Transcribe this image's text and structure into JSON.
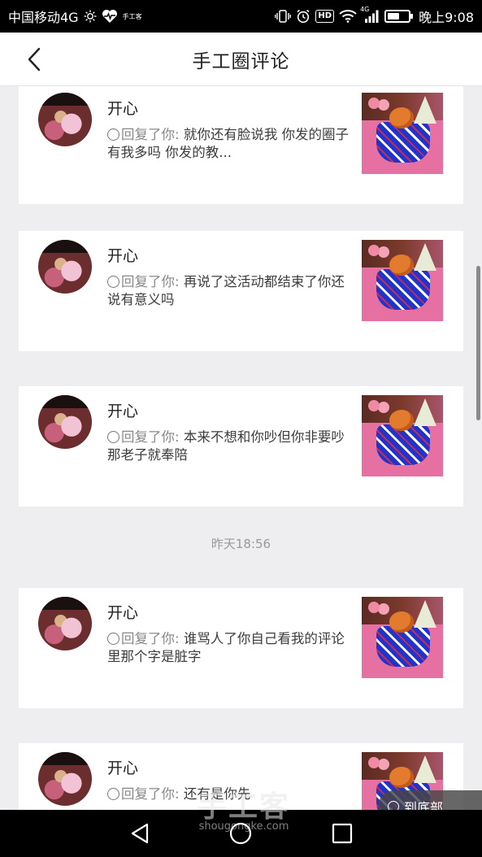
{
  "status_bar": {
    "carrier": "中国移动4G",
    "small_label": "手工客",
    "network_label": "4G",
    "hd_label": "HD",
    "time": "晚上9:08",
    "battery_level": 0.6
  },
  "header": {
    "title": "手工圈评论"
  },
  "comments": [
    {
      "username": "开心",
      "prefix": "回复了你:",
      "text": "就你还有脸说我 你发的圈子有我多吗 你发的教..."
    },
    {
      "username": "开心",
      "prefix": "回复了你:",
      "text": "再说了这活动都结束了你还说有意义吗"
    },
    {
      "username": "开心",
      "prefix": "回复了你:",
      "text": "本来不想和你吵但你非要吵那老子就奉陪"
    },
    {
      "username": "开心",
      "prefix": "回复了你:",
      "text": "谁骂人了你自己看我的评论里那个字是脏字"
    },
    {
      "username": "开心",
      "prefix": "回复了你:",
      "text": "还有是你先"
    }
  ],
  "time_separator": "昨天18:56",
  "float_button": {
    "label": "到底部"
  },
  "watermark": {
    "brand": "手工客",
    "domain": "shougongke.com"
  }
}
